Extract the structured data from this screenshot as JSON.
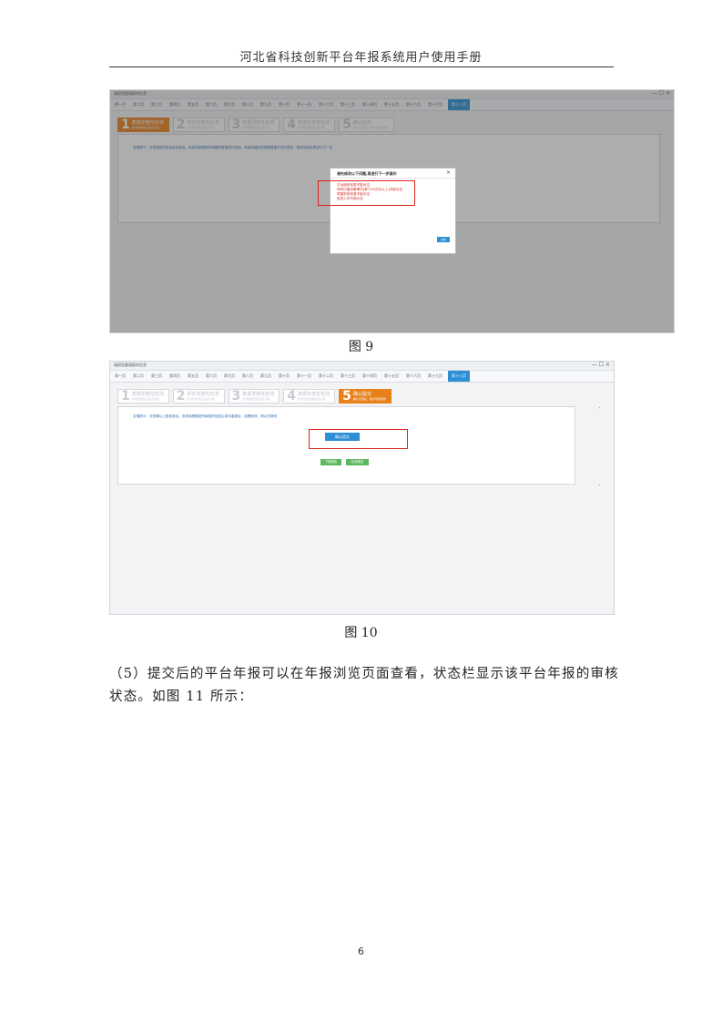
{
  "header": {
    "title": "河北省科技创新平台年报系统用户使用手册"
  },
  "figure9": {
    "window_title": "填报您要填报的信息",
    "window_controls": "— ☐ ×",
    "tabs": [
      "第一页",
      "第二页",
      "第三页",
      "第四页",
      "第五页",
      "第六页",
      "第七页",
      "第八页",
      "第九页",
      "第十页",
      "第十一页",
      "第十二页",
      "第十三页",
      "第十四页",
      "第十五页",
      "第十六页",
      "第十七页",
      "第十八页"
    ],
    "active_tab": 17,
    "steps": [
      {
        "num": "1",
        "name": "数据完整性检测",
        "sub": "检测数据信息是否完整"
      },
      {
        "num": "2",
        "name": "附件完整性检测",
        "sub": "检测附件信息是否完整"
      },
      {
        "num": "3",
        "name": "数据逻辑性检测",
        "sub": "检测数据逻辑是否正确"
      },
      {
        "num": "4",
        "name": "数据年度性检测",
        "sub": "检测年度数据是否正确"
      },
      {
        "num": "5",
        "name": "确认提交",
        "sub": "确认无误后，提交本年度报告"
      }
    ],
    "active_step": 0,
    "notice": "友情提示：在您填报完成全部信息后，系统将按照您所填报的数据进行检测，未检测通过的请按照提示进行修改，修改完成后再进行下一步",
    "modal": {
      "title": "请先修改以下问题,再进行下一步操作",
      "close": "×",
      "errors": [
        "平台组织信息不能为空",
        "现有仪器设备情况[单个50万元以上]不能为空",
        "附属机构信息不能为空",
        "投资人员不能为空"
      ],
      "button": "关闭"
    },
    "caption": "图 9"
  },
  "figure10": {
    "window_title": "填报您要填报的信息",
    "window_controls": "— ☐ ×",
    "tabs": [
      "第一页",
      "第二页",
      "第三页",
      "第四页",
      "第五页",
      "第六页",
      "第七页",
      "第八页",
      "第九页",
      "第十页",
      "第十一页",
      "第十二页",
      "第十三页",
      "第十四页",
      "第十五页",
      "第十六页",
      "第十七页",
      "第十八页"
    ],
    "active_tab": 17,
    "steps": [
      {
        "num": "1",
        "name": "数据完整性检测",
        "sub": "检测数据信息是否完整"
      },
      {
        "num": "2",
        "name": "附件完整性检测",
        "sub": "检测附件信息是否完整"
      },
      {
        "num": "3",
        "name": "数据逻辑性检测",
        "sub": "检测数据逻辑是否正确"
      },
      {
        "num": "4",
        "name": "数据年度性检测",
        "sub": "检测年度数据是否正确"
      },
      {
        "num": "5",
        "name": "确认提交",
        "sub": "确认无误后，提交年度报告"
      }
    ],
    "active_step": 4,
    "notice": "友情提示：在您确认上报信息后，系统将根据您所填报的信息生成年度报告，如需修改，请点击修改",
    "submit_button": "确认提交",
    "download_button": "下载报告",
    "preview_button": "在线预览",
    "caption": "图 10"
  },
  "body": {
    "paragraph": "（5）提交后的平台年报可以在年报浏览页面查看，状态栏显示该平台年报的审核状态。如图 11 所示："
  },
  "footer": {
    "page_number": "6"
  }
}
